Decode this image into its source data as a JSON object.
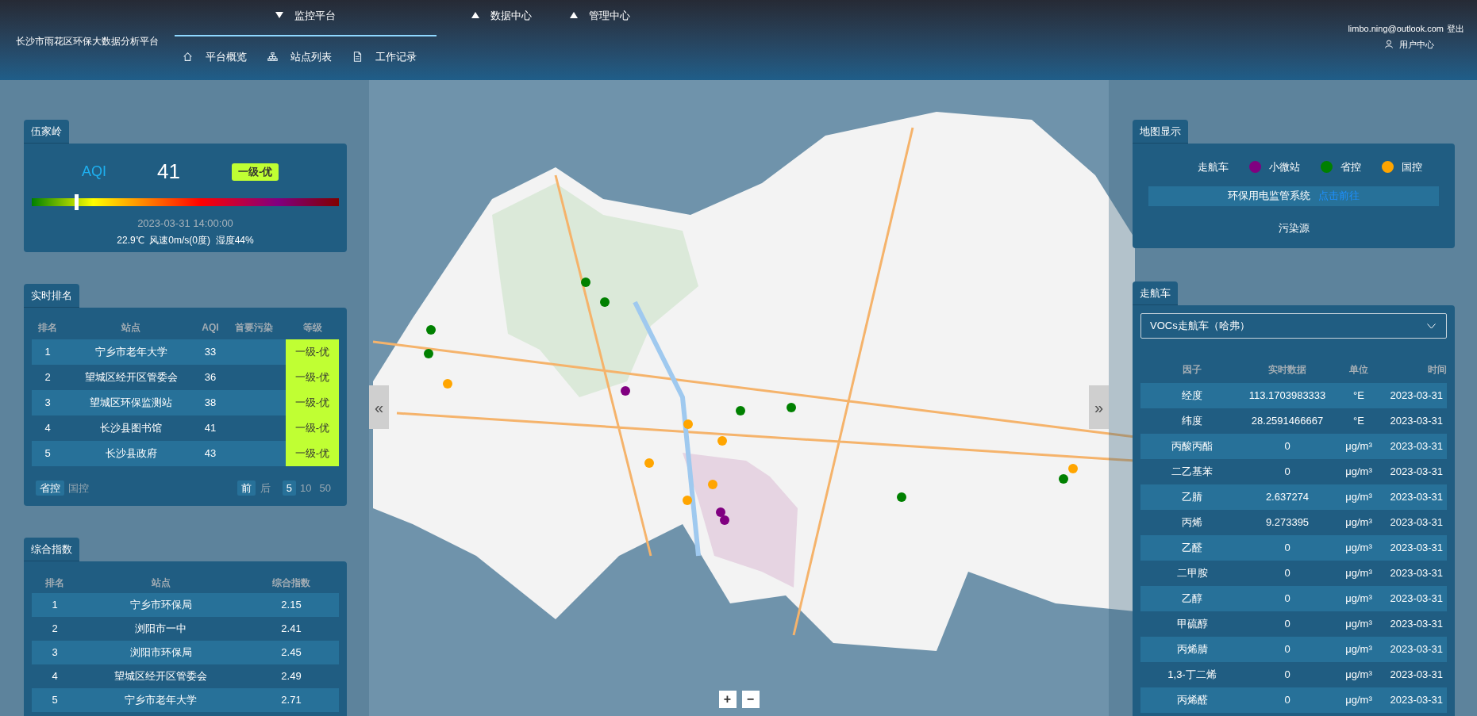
{
  "header": {
    "title": "长沙市雨花区环保大数据分析平台",
    "nav": [
      {
        "label": "监控平台",
        "selected": true,
        "expanded": true
      },
      {
        "label": "数据中心",
        "selected": false,
        "expanded": false
      },
      {
        "label": "管理中心",
        "selected": false,
        "expanded": false
      }
    ],
    "subnav": [
      {
        "label": "平台概览"
      },
      {
        "label": "站点列表"
      },
      {
        "label": "工作记录"
      }
    ],
    "user": {
      "email": "limbo.ning@outlook.com",
      "logout": "登出",
      "center": "用户中心"
    }
  },
  "station_card": {
    "tab": "伍家岭",
    "aqi_label": "AQI",
    "aqi_value": "41",
    "grade": "一级-优",
    "level": 0.14,
    "datetime": "2023-03-31 14:00:00",
    "weather": "22.9℃  风速0m/s(0度)  湿度44%"
  },
  "ranking": {
    "tab": "实时排名",
    "columns": [
      "排名",
      "站点",
      "AQI",
      "首要污染",
      "等级"
    ],
    "rows": [
      {
        "rank": "1",
        "station": "宁乡市老年大学",
        "aqi": "33",
        "grade": "一级-优"
      },
      {
        "rank": "2",
        "station": "望城区经开区管委会",
        "aqi": "36",
        "grade": "一级-优"
      },
      {
        "rank": "3",
        "station": "望城区环保监测站",
        "aqi": "38",
        "grade": "一级-优"
      },
      {
        "rank": "4",
        "station": "长沙县图书馆",
        "aqi": "41",
        "grade": "一级-优"
      },
      {
        "rank": "5",
        "station": "长沙县政府",
        "aqi": "43",
        "grade": "一级-优"
      }
    ],
    "filters": [
      {
        "label": "省控",
        "selected": true
      },
      {
        "label": "国控",
        "selected": false
      }
    ],
    "pager": [
      {
        "label": "前",
        "selected": true
      },
      {
        "label": "后",
        "selected": false
      }
    ],
    "sizes": [
      {
        "label": "5",
        "selected": true
      },
      {
        "label": "10",
        "selected": false
      },
      {
        "label": "50",
        "selected": false
      }
    ]
  },
  "composite": {
    "tab": "综合指数",
    "columns": [
      "排名",
      "站点",
      "综合指数"
    ],
    "rows": [
      {
        "rank": "1",
        "station": "宁乡市环保局",
        "index": "2.15"
      },
      {
        "rank": "2",
        "station": "浏阳市一中",
        "index": "2.41"
      },
      {
        "rank": "3",
        "station": "浏阳市环保局",
        "index": "2.45"
      },
      {
        "rank": "4",
        "station": "望城区经开区管委会",
        "index": "2.49"
      },
      {
        "rank": "5",
        "station": "宁乡市老年大学",
        "index": "2.71"
      }
    ]
  },
  "map_controls": {
    "collapse_left": "«",
    "collapse_right": "»",
    "zoom_in": "+",
    "zoom_out": "−"
  },
  "map_display": {
    "tab": "地图显示",
    "legend": [
      {
        "kind": "text",
        "label": "走航车"
      },
      {
        "kind": "dot",
        "label": "小微站",
        "color": "#800080"
      },
      {
        "kind": "dot",
        "label": "省控",
        "color": "#008000"
      },
      {
        "kind": "dot",
        "label": "国控",
        "color": "#ffa500"
      }
    ],
    "system": {
      "label": "环保用电监管系统",
      "link": "点击前往"
    },
    "source": "污染源"
  },
  "vehicle": {
    "tab": "走航车",
    "select": {
      "value": "VOCs走航车（哈弗）"
    },
    "columns": [
      "因子",
      "实时数据",
      "单位",
      "时间"
    ],
    "rows": [
      {
        "factor": "经度",
        "value": "113.1703983333",
        "unit": "°E",
        "time": "2023-03-31"
      },
      {
        "factor": "纬度",
        "value": "28.2591466667",
        "unit": "°E",
        "time": "2023-03-31"
      },
      {
        "factor": "丙酸丙酯",
        "value": "0",
        "unit": "μg/m³",
        "time": "2023-03-31"
      },
      {
        "factor": "二乙基苯",
        "value": "0",
        "unit": "μg/m³",
        "time": "2023-03-31"
      },
      {
        "factor": "乙腈",
        "value": "2.637274",
        "unit": "μg/m³",
        "time": "2023-03-31"
      },
      {
        "factor": "丙烯",
        "value": "9.273395",
        "unit": "μg/m³",
        "time": "2023-03-31"
      },
      {
        "factor": "乙醛",
        "value": "0",
        "unit": "μg/m³",
        "time": "2023-03-31"
      },
      {
        "factor": "二甲胺",
        "value": "0",
        "unit": "μg/m³",
        "time": "2023-03-31"
      },
      {
        "factor": "乙醇",
        "value": "0",
        "unit": "μg/m³",
        "time": "2023-03-31"
      },
      {
        "factor": "甲硫醇",
        "value": "0",
        "unit": "μg/m³",
        "time": "2023-03-31"
      },
      {
        "factor": "丙烯腈",
        "value": "0",
        "unit": "μg/m³",
        "time": "2023-03-31"
      },
      {
        "factor": "1,3-丁二烯",
        "value": "0",
        "unit": "μg/m³",
        "time": "2023-03-31"
      },
      {
        "factor": "丙烯醛",
        "value": "0",
        "unit": "μg/m³",
        "time": "2023-03-31"
      }
    ]
  }
}
